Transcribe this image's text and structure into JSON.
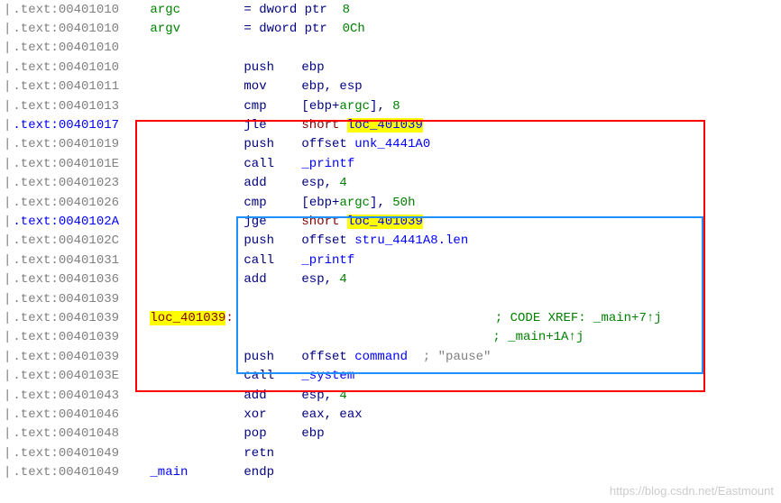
{
  "lines": [
    {
      "addr": ".text:00401010",
      "label": "argc",
      "labelClass": "var-green",
      "eq": "= dword ptr",
      "eqval": "8"
    },
    {
      "addr": ".text:00401010",
      "label": "argv",
      "labelClass": "var-green",
      "eq": "= dword ptr",
      "eqval": "0Ch"
    },
    {
      "addr": ".text:00401010"
    },
    {
      "addr": ".text:00401010",
      "mnem": "push",
      "op1": "ebp"
    },
    {
      "addr": ".text:00401011",
      "mnem": "mov",
      "op1": "ebp, esp"
    },
    {
      "addr": ".text:00401013",
      "mnem": "cmp",
      "op_parts": [
        {
          "t": "[",
          "c": "operand"
        },
        {
          "t": "ebp",
          "c": "operand"
        },
        {
          "t": "+",
          "c": "operand"
        },
        {
          "t": "argc",
          "c": "var-green"
        },
        {
          "t": "], ",
          "c": "operand"
        },
        {
          "t": "8",
          "c": "num-green"
        }
      ]
    },
    {
      "addr": ".text:00401017",
      "addrClass": "addr-blue",
      "mnem": "jle",
      "op_parts": [
        {
          "t": "short ",
          "c": "brown"
        },
        {
          "t": "loc_40",
          "c": "blue-ref",
          "hl": true
        },
        {
          "t": "1039",
          "c": "blue-ref",
          "hl": true
        }
      ]
    },
    {
      "addr": ".text:00401019",
      "mnem": "push",
      "op_parts": [
        {
          "t": "offset ",
          "c": "operand"
        },
        {
          "t": "unk_4441A0",
          "c": "blue-ref"
        }
      ]
    },
    {
      "addr": ".text:0040101E",
      "mnem": "call",
      "op_parts": [
        {
          "t": "_printf",
          "c": "blue-ref"
        }
      ]
    },
    {
      "addr": ".text:00401023",
      "mnem": "add",
      "op_parts": [
        {
          "t": "esp, ",
          "c": "operand"
        },
        {
          "t": "4",
          "c": "num-green"
        }
      ]
    },
    {
      "addr": ".text:00401026",
      "mnem": "cmp",
      "op_parts": [
        {
          "t": "[",
          "c": "operand"
        },
        {
          "t": "ebp",
          "c": "operand"
        },
        {
          "t": "+",
          "c": "operand"
        },
        {
          "t": "argc",
          "c": "var-green"
        },
        {
          "t": "], ",
          "c": "operand"
        },
        {
          "t": "50h",
          "c": "num-green"
        }
      ]
    },
    {
      "addr": ".text:0040102A",
      "addrClass": "addr-blue",
      "mnem": "jge",
      "op_parts": [
        {
          "t": "short ",
          "c": "brown"
        },
        {
          "t": "loc_401039",
          "c": "blue-ref",
          "hl": true
        }
      ]
    },
    {
      "addr": ".text:0040102C",
      "mnem": "push",
      "op_parts": [
        {
          "t": "offset ",
          "c": "operand"
        },
        {
          "t": "stru_4441A8.len",
          "c": "blue-ref"
        }
      ]
    },
    {
      "addr": ".text:00401031",
      "mnem": "call",
      "op_parts": [
        {
          "t": "_printf",
          "c": "blue-ref"
        }
      ]
    },
    {
      "addr": ".text:00401036",
      "mnem": "add",
      "op_parts": [
        {
          "t": "esp, ",
          "c": "operand"
        },
        {
          "t": "4",
          "c": "num-green"
        }
      ]
    },
    {
      "addr": ".text:00401039"
    },
    {
      "addr": ".text:00401039",
      "loc": "loc_401039",
      "xref": "; CODE XREF: _main+7↑j"
    },
    {
      "addr": ".text:00401039",
      "xref2": "; _main+1A↑j"
    },
    {
      "addr": ".text:00401039",
      "mnem": "push",
      "op_parts": [
        {
          "t": "offset ",
          "c": "operand"
        },
        {
          "t": "command",
          "c": "blue-ref"
        }
      ],
      "comment": "; \"pause\""
    },
    {
      "addr": ".text:0040103E",
      "mnem": "call",
      "op_parts": [
        {
          "t": "_system",
          "c": "blue-ref"
        }
      ]
    },
    {
      "addr": ".text:00401043",
      "mnem": "add",
      "op_parts": [
        {
          "t": "esp, ",
          "c": "operand"
        },
        {
          "t": "4",
          "c": "num-green"
        }
      ]
    },
    {
      "addr": ".text:00401046",
      "mnem": "xor",
      "op1": "eax, eax"
    },
    {
      "addr": ".text:00401048",
      "mnem": "pop",
      "op1": "ebp"
    },
    {
      "addr": ".text:00401049",
      "mnem": "retn"
    },
    {
      "addr": ".text:00401049",
      "label": "_main",
      "labelClass": "blue-ref",
      "mnem": "endp"
    }
  ],
  "watermark": "https://blog.csdn.net/Eastmount"
}
